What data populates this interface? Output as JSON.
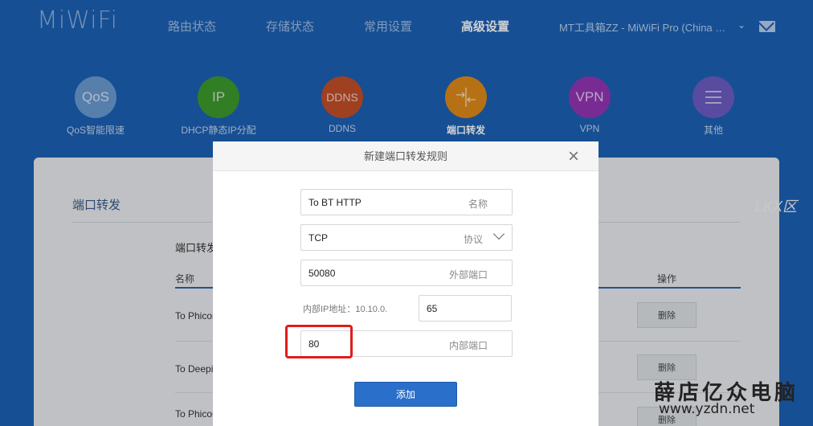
{
  "brand": {
    "logo": "MiWiFi"
  },
  "nav": {
    "items": [
      {
        "label": "路由状态"
      },
      {
        "label": "存储状态"
      },
      {
        "label": "常用设置"
      },
      {
        "label": "高级设置"
      }
    ],
    "active": "高级设置",
    "router_name": "MT工具箱ZZ - MiWiFi Pro (China Unic..."
  },
  "apps": [
    {
      "label": "QoS智能限速",
      "icon_text": "QoS",
      "color": "#6b9cd2"
    },
    {
      "label": "DHCP静态IP分配",
      "icon_text": "IP",
      "color": "#3d9a2e"
    },
    {
      "label": "DDNS",
      "icon_text": "DDNS",
      "color": "#c34f29"
    },
    {
      "label": "端口转发",
      "icon_text": "",
      "color": "#e08a1a"
    },
    {
      "label": "VPN",
      "icon_text": "VPN",
      "color": "#9435b5"
    },
    {
      "label": "其他",
      "icon_text": "",
      "color": "#6d5cc4"
    }
  ],
  "panel": {
    "title": "端口转发",
    "subtitle": "端口转发",
    "columns": {
      "name": "名称",
      "operation": "操作"
    },
    "rows": [
      {
        "name": "To Phicom",
        "action": "删除"
      },
      {
        "name": "To Deepin",
        "action": "删除"
      },
      {
        "name": "To Phicom",
        "action": "删除"
      }
    ]
  },
  "modal": {
    "title": "新建端口转发规则",
    "close_symbol": "×",
    "name_field": {
      "value": "To BT HTTP",
      "hint": "名称"
    },
    "protocol_field": {
      "value": "TCP",
      "hint": "协议"
    },
    "external_port": {
      "value": "50080",
      "hint": "外部端口"
    },
    "internal_ip_label": "内部IP地址：10.10.0.",
    "internal_ip_suffix": "65",
    "internal_port": {
      "value": "80",
      "hint": "内部端口"
    },
    "add_button": "添加"
  },
  "watermark": {
    "chinese": "薛店亿众电脑",
    "url": "www.yzdn.net",
    "faint": "LKX区"
  }
}
